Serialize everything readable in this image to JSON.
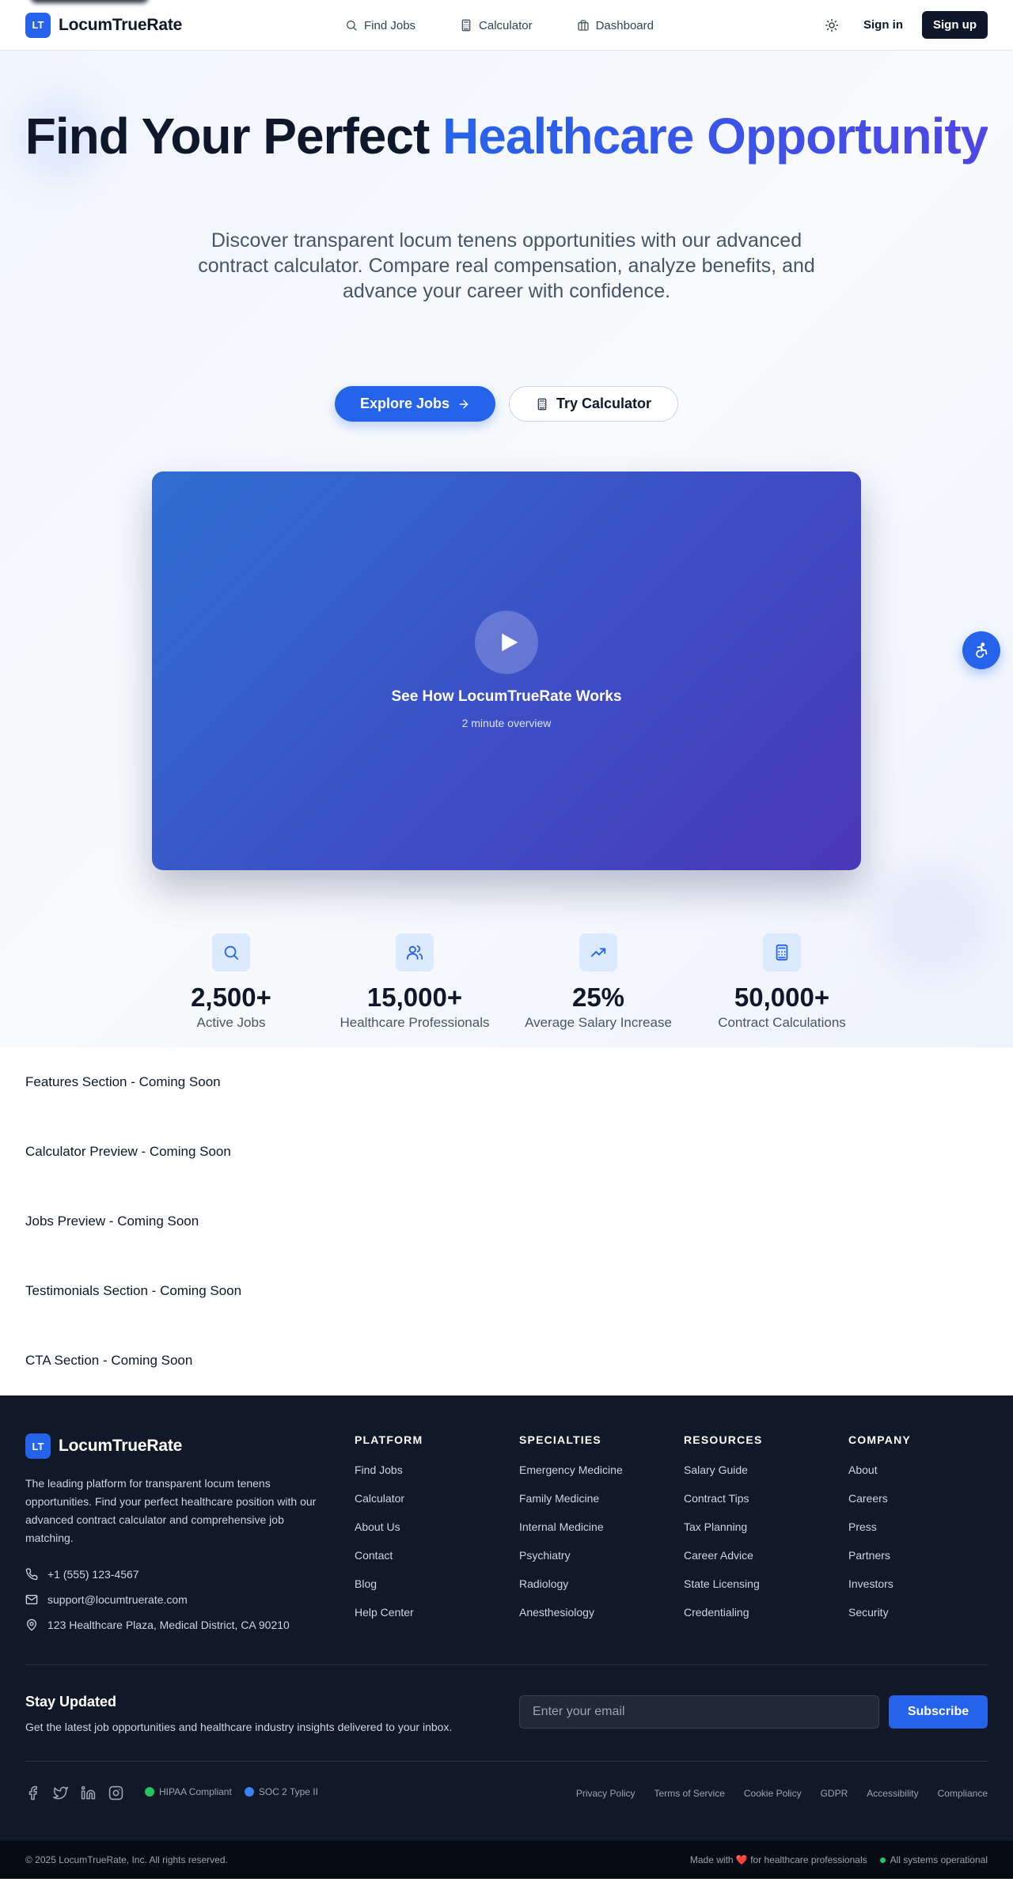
{
  "header": {
    "logo_text": "LT",
    "brand_name": "LocumTrueRate",
    "nav": [
      {
        "label": "Find Jobs",
        "icon": "search-icon"
      },
      {
        "label": "Calculator",
        "icon": "calculator-icon"
      },
      {
        "label": "Dashboard",
        "icon": "briefcase-icon"
      }
    ],
    "theme_icon": "sun-icon",
    "sign_in": "Sign in",
    "sign_up": "Sign up"
  },
  "hero": {
    "title_part1": "Find Your Perfect ",
    "title_accent": "Healthcare Opportunity",
    "subtitle": "Discover transparent locum tenens opportunities with our advanced contract calculator. Compare real compensation, analyze benefits, and advance your career with confidence.",
    "primary_cta": "Explore Jobs",
    "secondary_cta": "Try Calculator",
    "video": {
      "title": "See How LocumTrueRate Works",
      "subtitle": "2 minute overview"
    },
    "stats": [
      {
        "value": "2,500+",
        "label": "Active Jobs",
        "icon": "search-icon"
      },
      {
        "value": "15,000+",
        "label": "Healthcare Professionals",
        "icon": "users-icon"
      },
      {
        "value": "25%",
        "label": "Average Salary Increase",
        "icon": "trending-up-icon"
      },
      {
        "value": "50,000+",
        "label": "Contract Calculations",
        "icon": "calculator-icon"
      }
    ]
  },
  "placeholders": [
    "Features Section - Coming Soon",
    "Calculator Preview - Coming Soon",
    "Jobs Preview - Coming Soon",
    "Testimonials Section - Coming Soon",
    "CTA Section - Coming Soon"
  ],
  "footer": {
    "brand_name": "LocumTrueRate",
    "logo_text": "LT",
    "description": "The leading platform for transparent locum tenens opportunities. Find your perfect healthcare position with our advanced contract calculator and comprehensive job matching.",
    "contacts": [
      {
        "icon": "phone-icon",
        "text": "+1 (555) 123-4567"
      },
      {
        "icon": "mail-icon",
        "text": "support@locumtruerate.com"
      },
      {
        "icon": "map-pin-icon",
        "text": "123 Healthcare Plaza, Medical District, CA 90210"
      }
    ],
    "columns": [
      {
        "title": "PLATFORM",
        "links": [
          "Find Jobs",
          "Calculator",
          "About Us",
          "Contact",
          "Blog",
          "Help Center"
        ]
      },
      {
        "title": "SPECIALTIES",
        "links": [
          "Emergency Medicine",
          "Family Medicine",
          "Internal Medicine",
          "Psychiatry",
          "Radiology",
          "Anesthesiology"
        ]
      },
      {
        "title": "RESOURCES",
        "links": [
          "Salary Guide",
          "Contract Tips",
          "Tax Planning",
          "Career Advice",
          "State Licensing",
          "Credentialing"
        ]
      },
      {
        "title": "COMPANY",
        "links": [
          "About",
          "Careers",
          "Press",
          "Partners",
          "Investors",
          "Security"
        ]
      }
    ],
    "newsletter": {
      "title": "Stay Updated",
      "text": "Get the latest job opportunities and healthcare industry insights delivered to your inbox.",
      "placeholder": "Enter your email",
      "button": "Subscribe"
    },
    "socials": [
      "facebook-icon",
      "twitter-icon",
      "linkedin-icon",
      "instagram-icon"
    ],
    "badges": [
      {
        "label": "HIPAA Compliant",
        "color": "#22c55e"
      },
      {
        "label": "SOC 2 Type II",
        "color": "#3b82f6"
      }
    ],
    "legal": [
      "Privacy Policy",
      "Terms of Service",
      "Cookie Policy",
      "GDPR",
      "Accessibility",
      "Compliance"
    ],
    "copyright": "© 2025 LocumTrueRate, Inc. All rights reserved.",
    "made_with": "Made with ❤️ for healthcare professionals",
    "status": "All systems operational",
    "status_color": "#22c55e"
  },
  "colors": {
    "primary": "#2563eb",
    "dark": "#0f172a",
    "footer_bg": "#111827"
  }
}
